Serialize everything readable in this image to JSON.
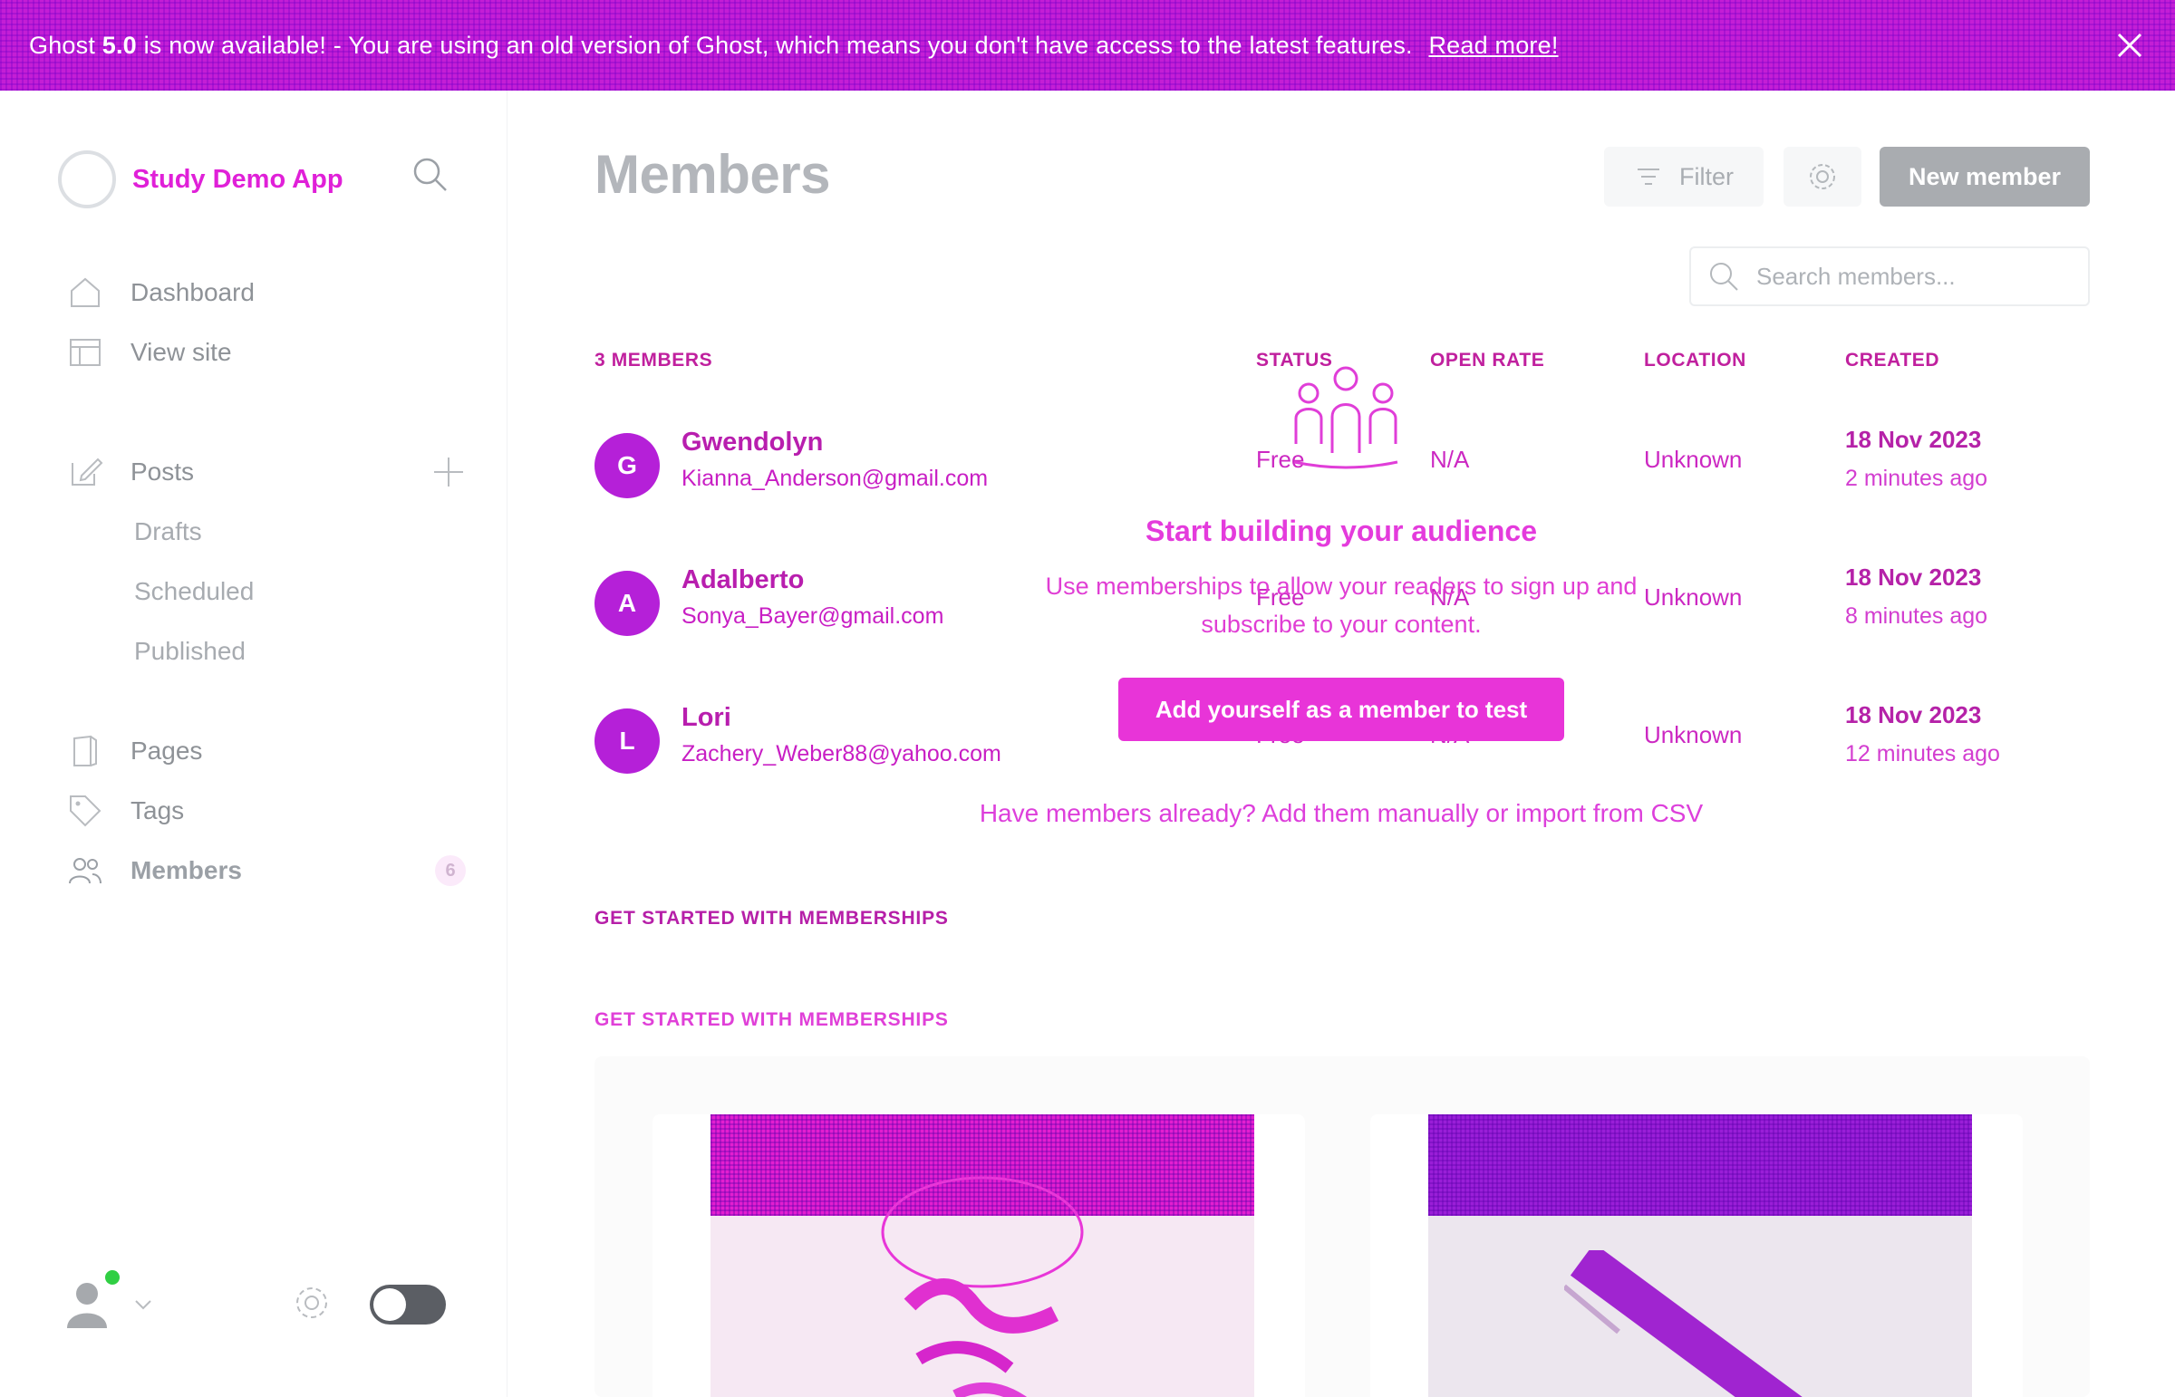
{
  "banner": {
    "text_prefix": "Ghost",
    "version": "5.0",
    "text_suffix": "is now available! - You are using an old version of Ghost, which means you don't have access to the latest features.",
    "link": "Read more!"
  },
  "brand": {
    "name": "Study Demo App"
  },
  "sidebar": {
    "items": [
      {
        "label": "Dashboard",
        "icon": "home-icon"
      },
      {
        "label": "View site",
        "icon": "view-site-icon"
      }
    ],
    "posts": {
      "label": "Posts",
      "icon": "edit-icon"
    },
    "post_sub": [
      "Drafts",
      "Scheduled",
      "Published"
    ],
    "lower": [
      {
        "label": "Pages",
        "icon": "pages-icon"
      },
      {
        "label": "Tags",
        "icon": "tag-icon"
      }
    ],
    "members": {
      "label": "Members",
      "icon": "members-icon",
      "count": "6"
    }
  },
  "page": {
    "title": "Members",
    "filter_label": "Filter",
    "new_label": "New member",
    "search_placeholder": "Search members..."
  },
  "table": {
    "count_label": "3 MEMBERS",
    "headers": {
      "status": "STATUS",
      "open_rate": "OPEN RATE",
      "location": "LOCATION",
      "created": "CREATED"
    },
    "rows": [
      {
        "initial": "G",
        "name": "Gwendolyn",
        "email": "Kianna_Anderson@gmail.com",
        "status": "Free",
        "open_rate": "N/A",
        "location": "Unknown",
        "date": "18 Nov 2023",
        "ago": "2 minutes ago"
      },
      {
        "initial": "A",
        "name": "Adalberto",
        "email": "Sonya_Bayer@gmail.com",
        "status": "Free",
        "open_rate": "N/A",
        "location": "Unknown",
        "date": "18 Nov 2023",
        "ago": "8 minutes ago"
      },
      {
        "initial": "L",
        "name": "Lori",
        "email": "Zachery_Weber88@yahoo.com",
        "status": "Free",
        "open_rate": "N/A",
        "location": "Unknown",
        "date": "18 Nov 2023",
        "ago": "12 minutes ago"
      }
    ]
  },
  "empty_state": {
    "title": "Start building your audience",
    "description": "Use memberships to allow your readers to sign up and subscribe to your content.",
    "button": "Add yourself as a member to test",
    "import_text": "Have members already? Add them manually or import from CSV"
  },
  "sections": {
    "get_started_a": "GET STARTED WITH MEMBERSHIPS",
    "get_started_b": "GET STARTED WITH MEMBERSHIPS"
  },
  "colors": {
    "accent": "#e020d8",
    "banner": "#c41ed6",
    "avatar": "#b520d8"
  }
}
